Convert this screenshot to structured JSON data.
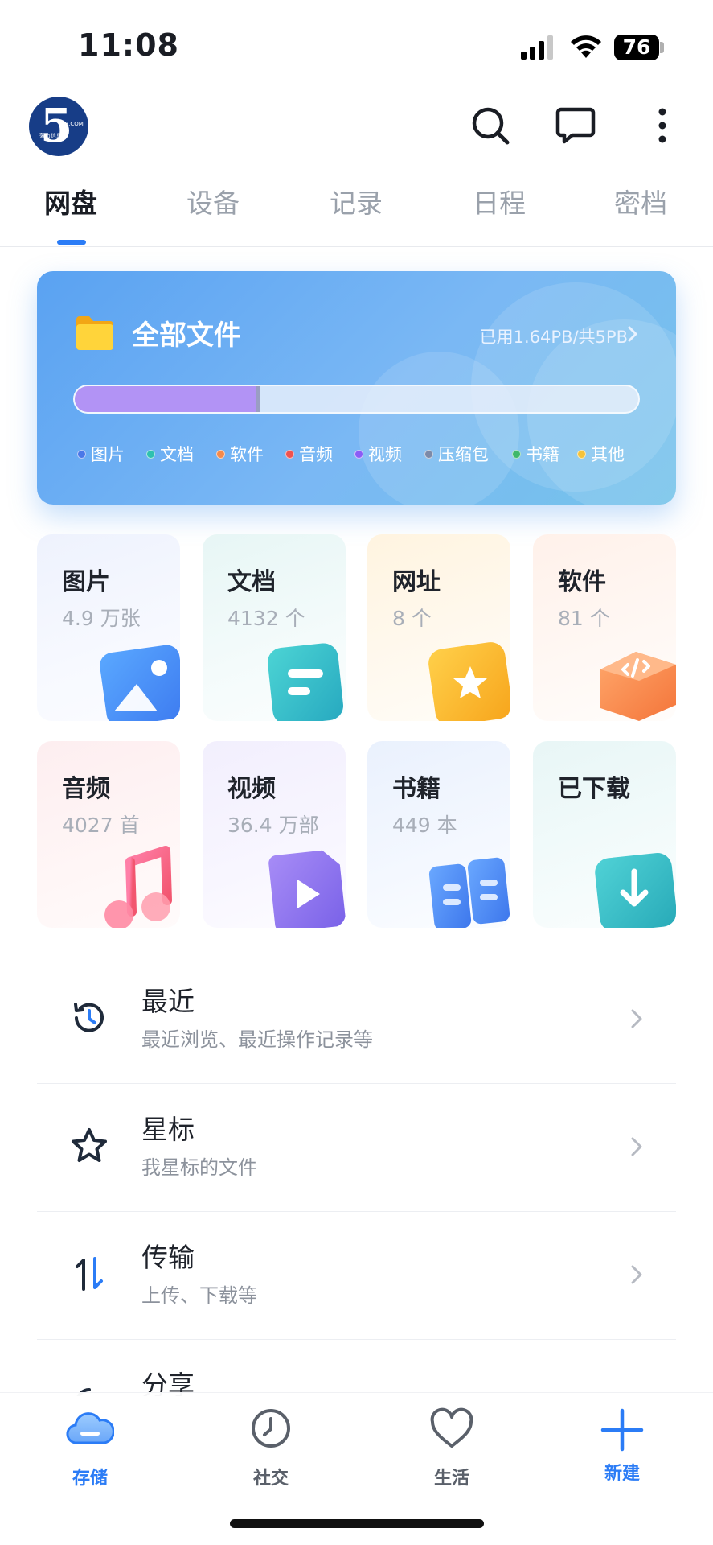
{
  "status_bar": {
    "time": "11:08",
    "battery": "76"
  },
  "header": {
    "logo_text": "5",
    "logo_small": "YIB.COM",
    "logo_brand": "藩市信息"
  },
  "tabs": [
    {
      "label": "网盘"
    },
    {
      "label": "设备"
    },
    {
      "label": "记录"
    },
    {
      "label": "日程"
    },
    {
      "label": "密档"
    }
  ],
  "active_tab_index": 0,
  "storage": {
    "title": "全部文件",
    "usage": "已用1.64PB/共5PB",
    "used_fraction": 0.33,
    "legend": [
      {
        "label": "图片",
        "color": "#4a78e8"
      },
      {
        "label": "文档",
        "color": "#2ec1b0"
      },
      {
        "label": "软件",
        "color": "#f58a4b"
      },
      {
        "label": "音频",
        "color": "#f0524f"
      },
      {
        "label": "视频",
        "color": "#8b5cf6"
      },
      {
        "label": "压缩包",
        "color": "#7c8aa8"
      },
      {
        "label": "书籍",
        "color": "#3fb86a"
      },
      {
        "label": "其他",
        "color": "#f5c33b"
      }
    ]
  },
  "categories": [
    {
      "title": "图片",
      "count": "4.9 万张",
      "icon": "image-icon"
    },
    {
      "title": "文档",
      "count": "4132 个",
      "icon": "document-icon"
    },
    {
      "title": "网址",
      "count": "8 个",
      "icon": "bookmark-star-icon"
    },
    {
      "title": "软件",
      "count": "81 个",
      "icon": "code-box-icon"
    },
    {
      "title": "音频",
      "count": "4027 首",
      "icon": "music-note-icon"
    },
    {
      "title": "视频",
      "count": "36.4 万部",
      "icon": "play-file-icon"
    },
    {
      "title": "书籍",
      "count": "449 本",
      "icon": "open-book-icon"
    },
    {
      "title": "已下载",
      "count": "",
      "icon": "download-icon"
    }
  ],
  "list": [
    {
      "title": "最近",
      "subtitle": "最近浏览、最近操作记录等",
      "icon": "history-icon"
    },
    {
      "title": "星标",
      "subtitle": "我星标的文件",
      "icon": "star-icon"
    },
    {
      "title": "传输",
      "subtitle": "上传、下载等",
      "icon": "transfer-icon"
    },
    {
      "title": "分享",
      "subtitle": "",
      "icon": "share-icon"
    }
  ],
  "bottom_nav": [
    {
      "label": "存储",
      "icon": "cloud-icon"
    },
    {
      "label": "社交",
      "icon": "clock-icon"
    },
    {
      "label": "生活",
      "icon": "heart-icon"
    },
    {
      "label": "新建",
      "icon": "plus-icon"
    }
  ],
  "accent_color": "#2b7cf6"
}
